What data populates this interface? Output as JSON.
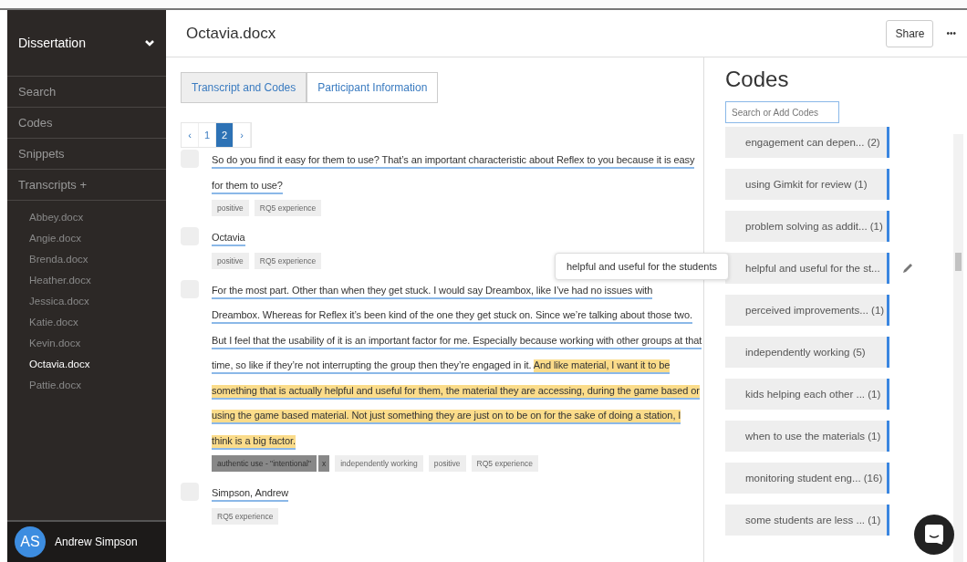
{
  "sidebar": {
    "project": "Dissertation",
    "sections": [
      {
        "label": "Search"
      },
      {
        "label": "Codes"
      },
      {
        "label": "Snippets"
      },
      {
        "label": "Transcripts +"
      }
    ],
    "files": [
      {
        "label": "Abbey.docx",
        "selected": false
      },
      {
        "label": "Angie.docx",
        "selected": false
      },
      {
        "label": "Brenda.docx",
        "selected": false
      },
      {
        "label": "Heather.docx",
        "selected": false
      },
      {
        "label": "Jessica.docx",
        "selected": false
      },
      {
        "label": "Katie.docx",
        "selected": false
      },
      {
        "label": "Kevin.docx",
        "selected": false
      },
      {
        "label": "Octavia.docx",
        "selected": true
      },
      {
        "label": "Pattie.docx",
        "selected": false
      }
    ],
    "user": {
      "initials": "AS",
      "name": "Andrew Simpson"
    }
  },
  "document": {
    "title": "Octavia.docx",
    "share": "Share",
    "more": "•••",
    "tabs": [
      {
        "label": "Transcript and Codes",
        "selected": true
      },
      {
        "label": "Participant Information",
        "selected": false
      }
    ],
    "pagination": [
      {
        "label": "‹",
        "selected": false
      },
      {
        "label": "1",
        "selected": false
      },
      {
        "label": "2",
        "selected": true
      },
      {
        "label": "›",
        "selected": false
      }
    ],
    "blocks": [
      {
        "segments": [
          {
            "text": "So do you find it easy for them to use? That’s an important characteristic about Reflex to you because it is easy for them to use?",
            "highlighted": false
          }
        ],
        "tags": [
          {
            "label": "positive",
            "selected": false
          },
          {
            "label": "RQ5 experience",
            "selected": false
          }
        ]
      },
      {
        "segments": [
          {
            "text": "Octavia",
            "highlighted": false
          }
        ],
        "tags": [
          {
            "label": "positive",
            "selected": false
          },
          {
            "label": "RQ5 experience",
            "selected": false
          }
        ]
      },
      {
        "segments": [
          {
            "text": "For the most part. Other than when they get stuck. I would say Dreambox, like I’ve had no issues with Dreambox. Whereas for Reflex it’s been kind of the one they get stuck on. Since we’re talking about those two. But I feel that the usability of it is an important factor for me. Especially because working with other groups at that time, so like if they’re not interrupting the group then they’re engaged in it. ",
            "highlighted": false
          },
          {
            "text": "And like material, I want it to be something that is actually helpful and useful for them, the material they are accessing, during the game based or using the game based material. Not just something they are just on to be on for the sake of doing a station, I think is a big factor.",
            "highlighted": true
          }
        ],
        "tags": [
          {
            "label": "authentic use - \"intentional\"",
            "selected": true,
            "remove": "x"
          },
          {
            "label": "independently working",
            "selected": false
          },
          {
            "label": "positive",
            "selected": false
          },
          {
            "label": "RQ5 experience",
            "selected": false
          }
        ]
      },
      {
        "segments": [
          {
            "text": "Simpson, Andrew",
            "highlighted": false
          }
        ],
        "tags": [
          {
            "label": "RQ5 experience",
            "selected": false
          }
        ]
      }
    ]
  },
  "codes": {
    "title": "Codes",
    "search": {
      "placeholder": "Search or Add Codes"
    },
    "tooltip": "helpful and useful for the students",
    "items": [
      {
        "label": "engagement can depen...  (2)",
        "hovered": false
      },
      {
        "label": "using Gimkit for review (1)",
        "hovered": false
      },
      {
        "label": "problem solving as addit... (1)",
        "hovered": false
      },
      {
        "label": "helpful and useful for the st...",
        "hovered": true
      },
      {
        "label": "perceived improvements... (1)",
        "hovered": false
      },
      {
        "label": "independently working (5)",
        "hovered": false
      },
      {
        "label": "kids helping each other ...  (1)",
        "hovered": false
      },
      {
        "label": "when to use the materials (1)",
        "hovered": false
      },
      {
        "label": "monitoring student eng... (16)",
        "hovered": false
      },
      {
        "label": "some students are less ...  (1)",
        "hovered": false
      }
    ]
  }
}
